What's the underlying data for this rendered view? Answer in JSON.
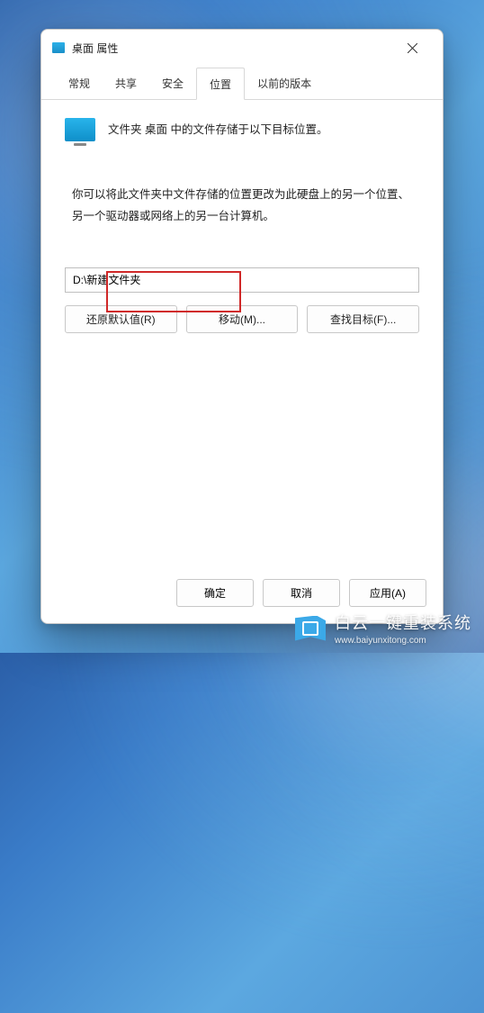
{
  "window": {
    "title": "桌面 属性"
  },
  "tabs": {
    "general": "常规",
    "sharing": "共享",
    "security": "安全",
    "location": "位置",
    "previous": "以前的版本"
  },
  "location": {
    "info": "文件夹 桌面 中的文件存储于以下目标位置。",
    "description": "你可以将此文件夹中文件存储的位置更改为此硬盘上的另一个位置、另一个驱动器或网络上的另一台计算机。",
    "path_value": "D:\\新建文件夹",
    "restore": "还原默认值(R)",
    "move": "移动(M)...",
    "find": "查找目标(F)..."
  },
  "footer": {
    "ok": "确定",
    "cancel": "取消",
    "apply": "应用(A)"
  },
  "watermark": {
    "title": "白云一键重装系统",
    "url": "www.baiyunxitong.com"
  }
}
